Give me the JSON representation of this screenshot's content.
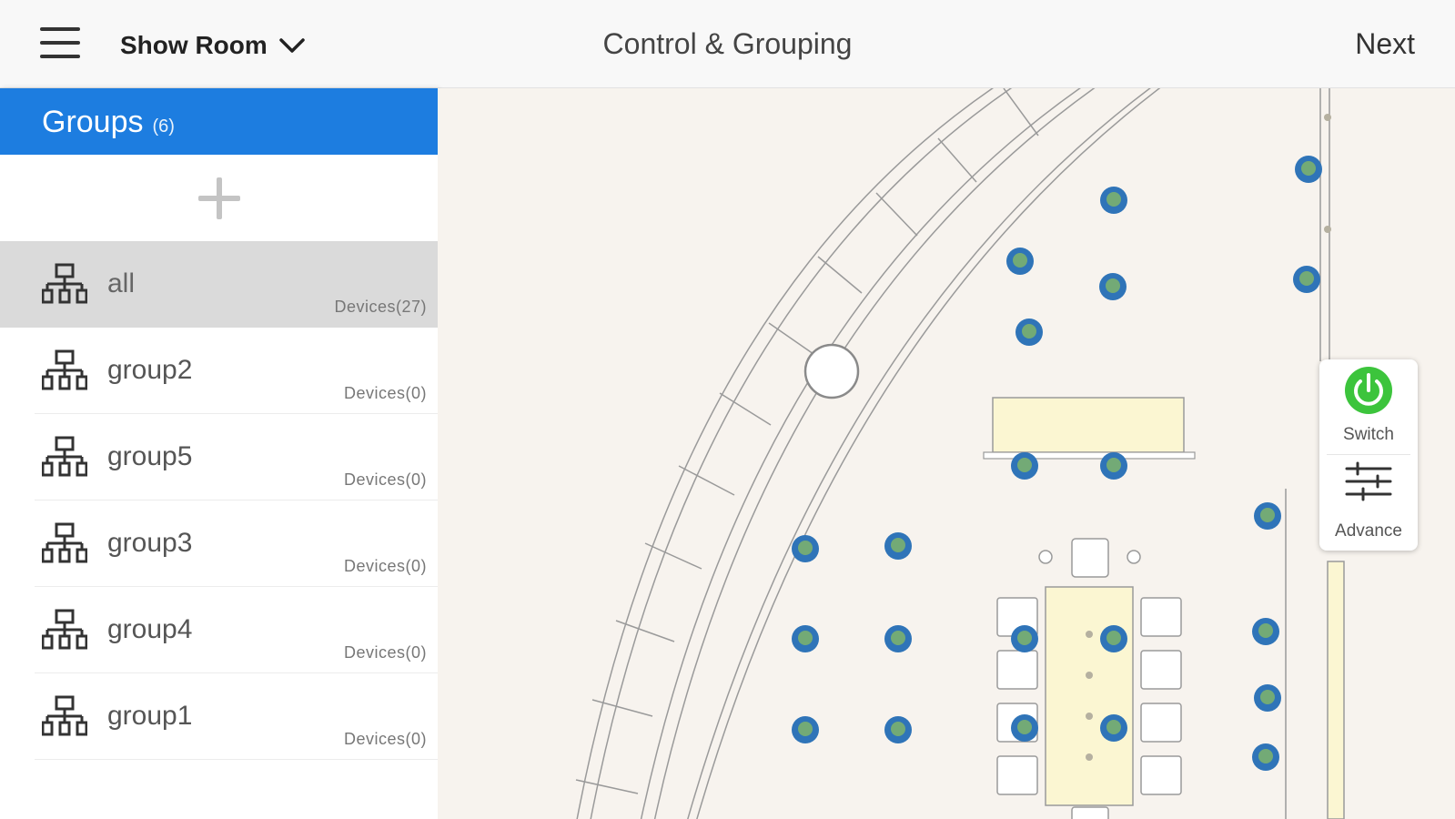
{
  "header": {
    "room_name": "Show Room",
    "title": "Control & Grouping",
    "next_label": "Next"
  },
  "sidebar": {
    "title": "Groups",
    "count": "(6)",
    "groups": [
      {
        "name": "all",
        "devices": "Devices(27)",
        "selected": true
      },
      {
        "name": "group2",
        "devices": "Devices(0)"
      },
      {
        "name": "group5",
        "devices": "Devices(0)"
      },
      {
        "name": "group3",
        "devices": "Devices(0)"
      },
      {
        "name": "group4",
        "devices": "Devices(0)"
      },
      {
        "name": "group1",
        "devices": "Devices(0)"
      }
    ]
  },
  "panel": {
    "switch_label": "Switch",
    "advance_label": "Advance"
  },
  "colors": {
    "accent": "#1d7de0",
    "power": "#3cc43c",
    "device": "#2f74b8",
    "map_bg": "#f7f3ee",
    "table_fill": "#fbf6d2"
  },
  "icons": [
    "menu-icon",
    "chevron-down-icon",
    "plus-icon",
    "group-tree-icon",
    "power-icon",
    "sliders-icon"
  ]
}
